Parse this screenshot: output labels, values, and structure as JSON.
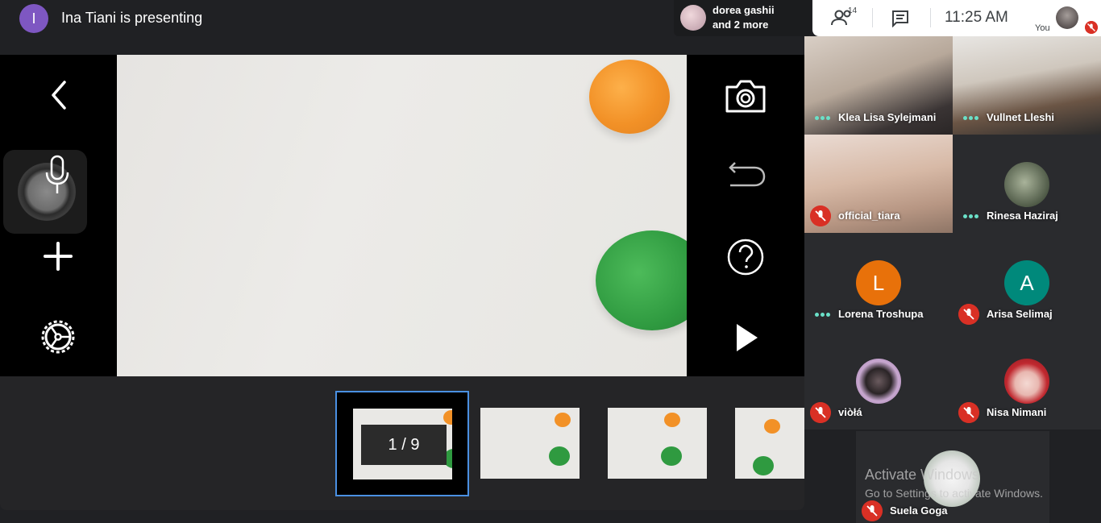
{
  "presenter": {
    "avatar_letter": "I",
    "text": "Ina Tiani is presenting",
    "avatar_color": "#7e57c2"
  },
  "notification": {
    "line1": "dorea gashii",
    "line2": "and 2 more"
  },
  "topbar": {
    "participants_count": "14",
    "time": "11:25  AM",
    "you_label": "You",
    "icons": [
      "people-icon",
      "chat-icon",
      "mic-off-icon"
    ]
  },
  "presentation": {
    "left_controls": [
      "back-icon",
      "mic-icon",
      "plus-icon",
      "gear-icon"
    ],
    "right_controls": [
      "camera-icon",
      "undo-icon",
      "help-icon",
      "play-icon"
    ],
    "slide_colors": {
      "orange": "#f29127",
      "green": "#2f9a40"
    }
  },
  "filmstrip": {
    "page_indicator": "1 / 9",
    "selected_border": "#4a90e2"
  },
  "participants": [
    {
      "name": "Klea Lisa Sylejmani",
      "status": "speaking"
    },
    {
      "name": "Vullnet Lleshi",
      "status": "speaking"
    },
    {
      "name": "official_tiara",
      "status": "muted"
    },
    {
      "name": "Rinesa Haziraj",
      "status": "speaking"
    },
    {
      "name": "Lorena Troshupa",
      "status": "speaking",
      "avatar_letter": "L",
      "avatar_color": "#e8710a"
    },
    {
      "name": "Arisa Selimaj",
      "status": "muted",
      "avatar_letter": "A",
      "avatar_color": "#00897b"
    },
    {
      "name": "viòłá",
      "status": "muted"
    },
    {
      "name": "Nisa Nimani",
      "status": "muted"
    },
    {
      "name": "Suela Goga",
      "status": "muted"
    }
  ],
  "watermark": {
    "line1": "Activate Windows",
    "line2": "Go to Settings to activate Windows."
  }
}
